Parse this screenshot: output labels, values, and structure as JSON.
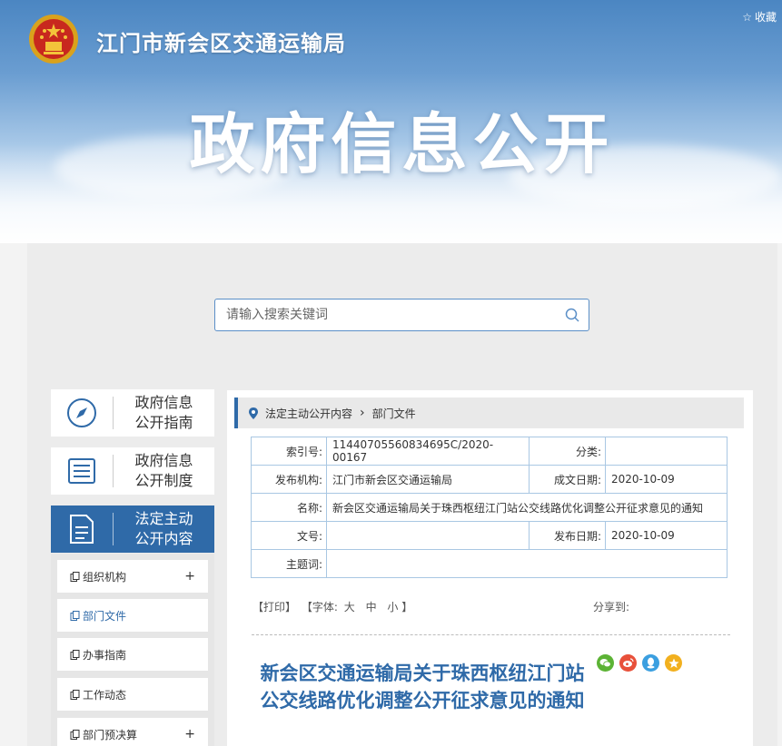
{
  "header": {
    "site_title": "江门市新会区交通运输局",
    "favorite_label": "收藏",
    "banner_title": "政府信息公开"
  },
  "search": {
    "placeholder": "请输入搜索关键词"
  },
  "left_nav": [
    {
      "line1": "政府信息",
      "line2": "公开指南",
      "icon": "compass-icon"
    },
    {
      "line1": "政府信息",
      "line2": "公开制度",
      "icon": "list-icon"
    },
    {
      "line1": "法定主动",
      "line2": "公开内容",
      "icon": "document-icon",
      "active": true
    }
  ],
  "sub_nav": [
    {
      "label": "组织机构",
      "expandable": "+"
    },
    {
      "label": "部门文件",
      "selected": true
    },
    {
      "label": "办事指南"
    },
    {
      "label": "工作动态"
    },
    {
      "label": "部门预决算",
      "expandable": "+"
    }
  ],
  "breadcrumb": {
    "level1": "法定主动公开内容",
    "level2": "部门文件"
  },
  "meta": {
    "index_label": "索引号:",
    "index_value": "11440705560834695C/2020-00167",
    "category_label": "分类:",
    "category_value": "",
    "publisher_label": "发布机构:",
    "publisher_value": "江门市新会区交通运输局",
    "created_label": "成文日期:",
    "created_value": "2020-10-09",
    "name_label": "名称:",
    "name_value": "新会区交通运输局关于珠西枢纽江门站公交线路优化调整公开征求意见的通知",
    "docno_label": "文号:",
    "docno_value": "",
    "published_label": "发布日期:",
    "published_value": "2020-10-09",
    "keywords_label": "主题词:",
    "keywords_value": ""
  },
  "tools": {
    "print": "【打印】",
    "font_prefix": "【字体:",
    "font_large": "大",
    "font_medium": "中",
    "font_small": "小",
    "font_suffix": "】",
    "share_label": "分享到:"
  },
  "document": {
    "title": "新会区交通运输局关于珠西枢纽江门站公交线路优化调整公开征求意见的通知"
  },
  "colors": {
    "accent": "#2f6aa8",
    "table_border": "#a9c7e3"
  }
}
